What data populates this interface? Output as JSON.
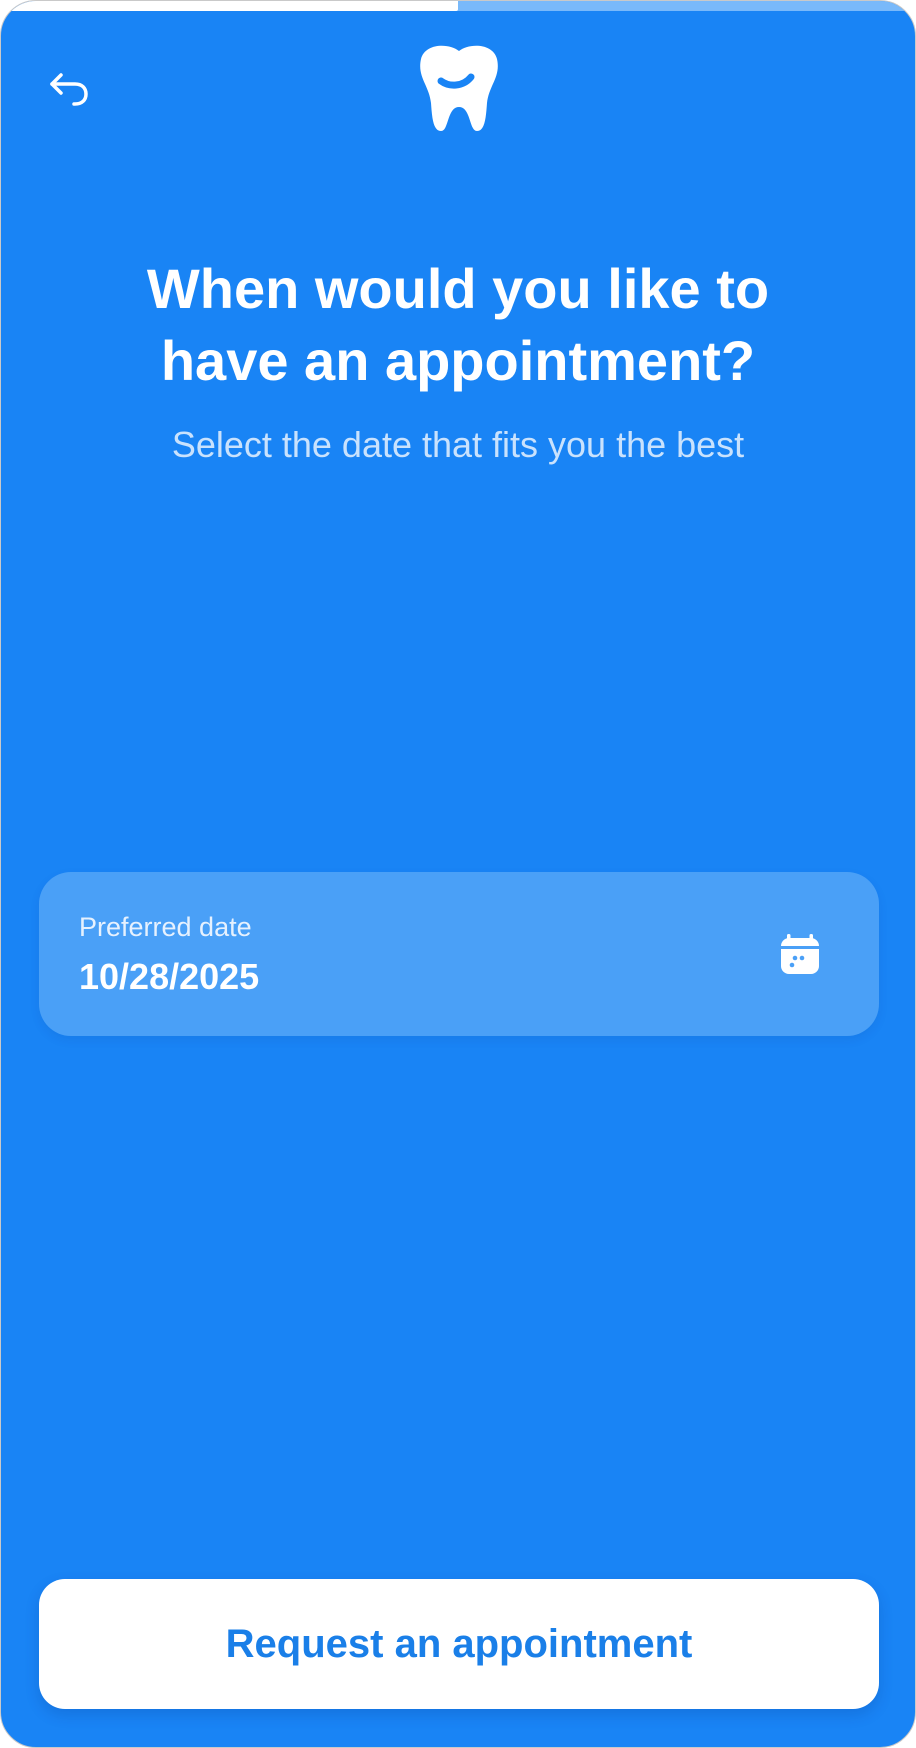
{
  "progress": {
    "value": 0.5
  },
  "header": {
    "back_icon": "back-arrow-icon",
    "logo_icon": "tooth-icon"
  },
  "main": {
    "title": "When would you like to have an appointment?",
    "subtitle": "Select the date that fits you the best"
  },
  "date_field": {
    "label": "Preferred date",
    "value": "10/28/2025",
    "icon": "calendar-icon"
  },
  "footer": {
    "request_label": "Request an appointment"
  },
  "colors": {
    "background": "#1984f5",
    "field_background": "#4aa0f7",
    "button_text": "#1a7fe8",
    "progress_track": "#79b9fa",
    "progress_fill": "#ffffff"
  }
}
